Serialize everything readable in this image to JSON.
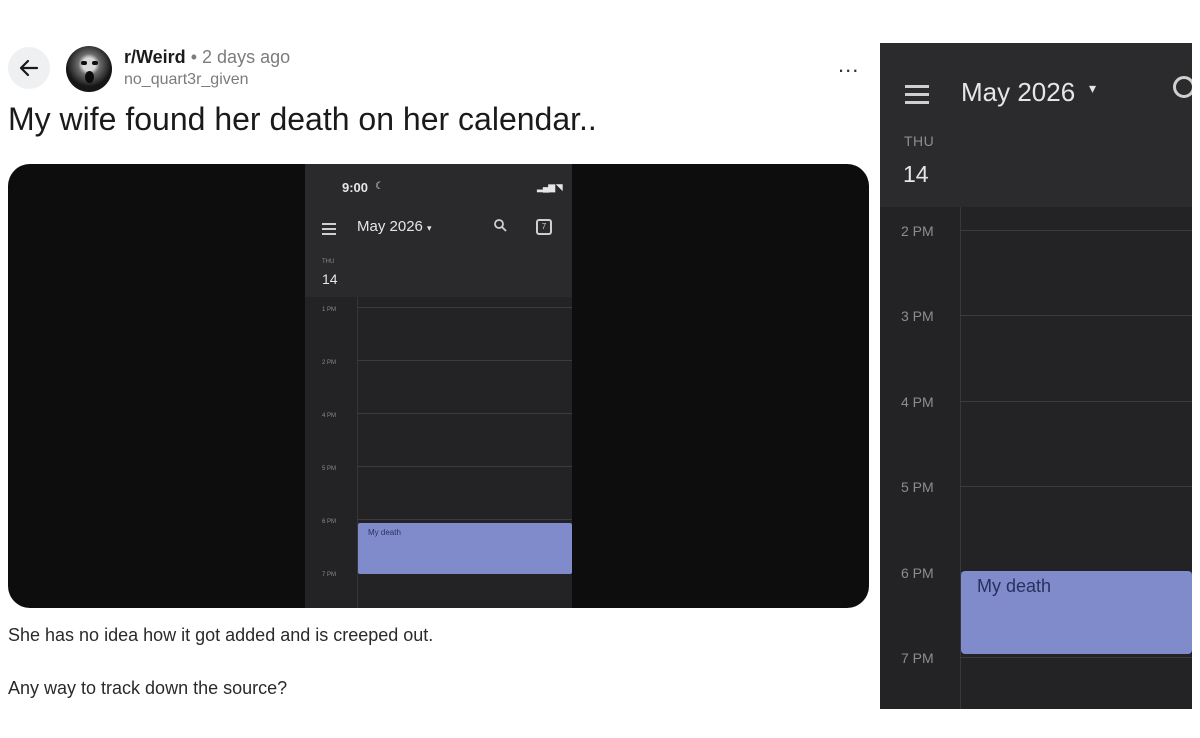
{
  "post": {
    "subreddit": "r/Weird",
    "separator": "•",
    "time_ago": "2 days ago",
    "author": "no_quart3r_given",
    "more_label": "...",
    "title": "My wife found her death on her calendar..",
    "body": [
      "She has no idea how it got added and is creeped out.",
      "Any way to track down the source?"
    ]
  },
  "phone_screenshot": {
    "status_time": "9:00",
    "month_label": "May 2026",
    "caret": "▾",
    "search_icon": "search-icon",
    "today_icon": "calendar-today-icon",
    "today_glyph": "7",
    "day_of_week": "THU",
    "day_number": "14",
    "hours": [
      "1 PM",
      "2 PM",
      "4 PM",
      "5 PM",
      "6 PM",
      "7 PM"
    ],
    "event": {
      "title": "My death",
      "color": "#7f8bcb",
      "start_hour": "6 PM"
    }
  },
  "zoomed_calendar": {
    "month_label": "May 2026",
    "caret": "▾",
    "day_of_week": "THU",
    "day_number": "14",
    "hours": [
      "2 PM",
      "3 PM",
      "4 PM",
      "5 PM",
      "6 PM",
      "7 PM"
    ],
    "event": {
      "title": "My death",
      "color": "#7f8bcb",
      "start_hour": "6 PM"
    }
  },
  "colors": {
    "calendar_background": "#232325",
    "event_fill": "#7f8bcb",
    "media_background": "#0d0d0e"
  }
}
